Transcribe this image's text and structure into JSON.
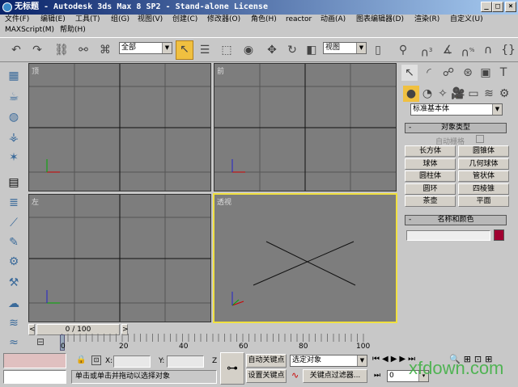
{
  "title": {
    "text": "无标题 - Autodesk 3ds Max 8 SP2 - Stand-alone License",
    "min": "_",
    "max": "□",
    "close": "×"
  },
  "menu": [
    "文件(F)",
    "编辑(E)",
    "工具(T)",
    "组(G)",
    "视图(V)",
    "创建(C)",
    "修改器(O)",
    "角色(H)",
    "reactor",
    "动画(A)",
    "图表编辑器(D)",
    "渲染(R)",
    "自定义(U)",
    "MAXScript(M)",
    "帮助(H)"
  ],
  "toolbar": {
    "selection_filter": "全部",
    "coord_system": "视图",
    "snap_label": "3",
    "angle_label": "%"
  },
  "viewports": [
    {
      "label": "顶"
    },
    {
      "label": "前"
    },
    {
      "label": "左"
    },
    {
      "label": "透视"
    }
  ],
  "timeline": {
    "frame_display": "0 / 100",
    "ticks": [
      "0",
      "20",
      "40",
      "60",
      "80",
      "100"
    ],
    "prev": "<",
    "next": ">"
  },
  "right_panel": {
    "category": "标准基本体",
    "object_type": {
      "header": "对象类型",
      "auto_grid": "自动栅格",
      "buttons": [
        "长方体",
        "圆锥体",
        "球体",
        "几何球体",
        "圆柱体",
        "管状体",
        "圆环",
        "四棱锥",
        "茶壶",
        "平面"
      ]
    },
    "name_color": {
      "header": "名称和颜色",
      "name_value": "",
      "color": "#a00030"
    },
    "collapse": "-"
  },
  "status": {
    "x_label": "X:",
    "y_label": "Y:",
    "z_label": "Z",
    "prompt": "单击或单击并拖动以选择对象",
    "auto_key": "自动关键点",
    "set_key": "设置关键点",
    "key_mode": "选定对象",
    "key_filters": "关键点过滤器...",
    "frame": "0"
  },
  "watermark": "xfdown.com"
}
